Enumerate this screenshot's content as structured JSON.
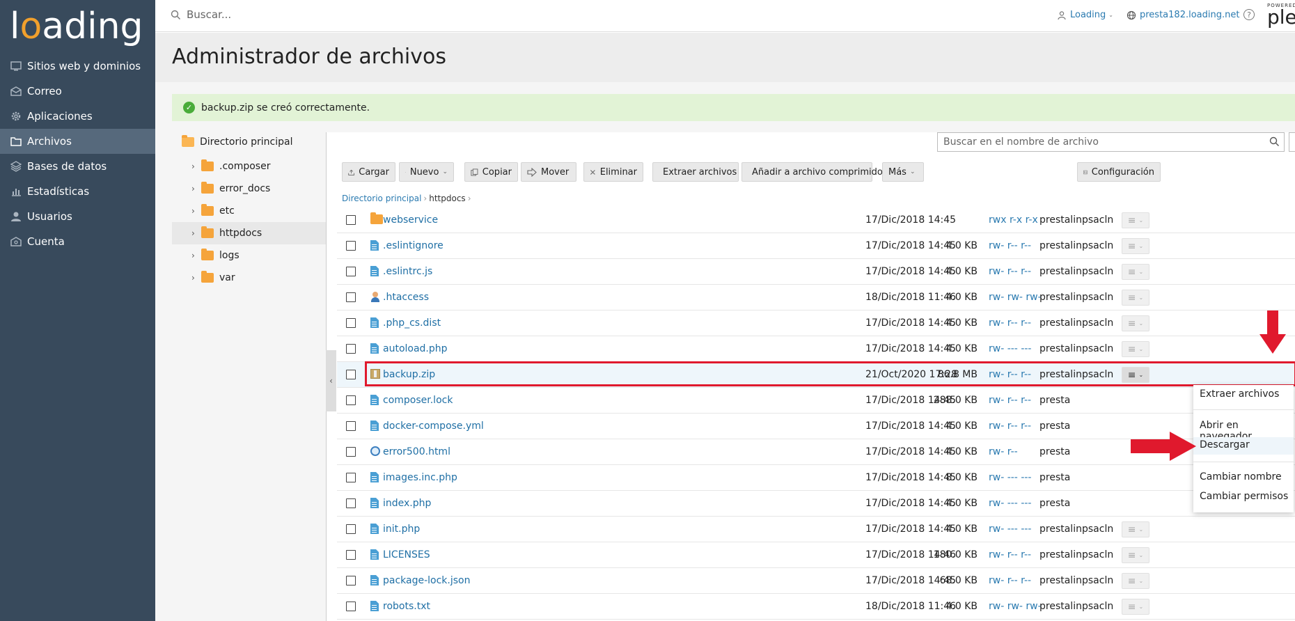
{
  "brand": {
    "logo_prefix": "l",
    "logo_o": "o",
    "logo_suffix": "ading"
  },
  "sidebar": {
    "items": [
      {
        "label": "Sitios web y dominios",
        "icon": "monitor-icon"
      },
      {
        "label": "Correo",
        "icon": "mail-icon"
      },
      {
        "label": "Aplicaciones",
        "icon": "gear-icon"
      },
      {
        "label": "Archivos",
        "icon": "folder-icon",
        "active": true
      },
      {
        "label": "Bases de datos",
        "icon": "database-icon"
      },
      {
        "label": "Estadísticas",
        "icon": "chart-icon"
      },
      {
        "label": "Usuarios",
        "icon": "user-icon"
      },
      {
        "label": "Cuenta",
        "icon": "account-icon"
      }
    ]
  },
  "topbar": {
    "search_placeholder": "Buscar...",
    "user": "Loading",
    "domain": "presta182.loading.net",
    "help": "?",
    "powered": "POWERED",
    "plesk": "ples"
  },
  "page": {
    "title": "Administrador de archivos",
    "alert": "backup.zip se creó correctamente."
  },
  "tree": {
    "root": "Directorio principal",
    "items": [
      {
        "label": ".composer"
      },
      {
        "label": "error_docs"
      },
      {
        "label": "etc"
      },
      {
        "label": "httpdocs",
        "active": true
      },
      {
        "label": "logs"
      },
      {
        "label": "var"
      }
    ]
  },
  "files": {
    "search_placeholder": "Buscar en el nombre de archivo",
    "toolbar": {
      "upload": "Cargar",
      "new": "Nuevo",
      "copy": "Copiar",
      "move": "Mover",
      "delete": "Eliminar",
      "extract": "Extraer archivos",
      "add_archive": "Añadir a archivo comprimido",
      "more": "Más",
      "settings": "Configuración"
    },
    "breadcrumb": {
      "root": "Directorio principal",
      "current": "httpdocs"
    },
    "rows": [
      {
        "name": "webservice",
        "type": "folder",
        "date": "17/Dic/2018 14:45",
        "size": "",
        "perm": "rwx r-x r-x",
        "user": "prestalin",
        "group": "psacln"
      },
      {
        "name": ".eslintignore",
        "type": "doc",
        "date": "17/Dic/2018 14:45",
        "size": "4.0 KB",
        "perm": "rw- r-- r--",
        "user": "prestalin",
        "group": "psacln"
      },
      {
        "name": ".eslintrc.js",
        "type": "doc",
        "date": "17/Dic/2018 14:45",
        "size": "4.0 KB",
        "perm": "rw- r-- r--",
        "user": "prestalin",
        "group": "psacln"
      },
      {
        "name": ".htaccess",
        "type": "htaccess",
        "date": "18/Dic/2018 11:46",
        "size": "4.0 KB",
        "perm": "rw- rw- rw-",
        "user": "prestalin",
        "group": "psacln"
      },
      {
        "name": ".php_cs.dist",
        "type": "doc",
        "date": "17/Dic/2018 14:45",
        "size": "4.0 KB",
        "perm": "rw- r-- r--",
        "user": "prestalin",
        "group": "psacln"
      },
      {
        "name": "autoload.php",
        "type": "doc",
        "date": "17/Dic/2018 14:45",
        "size": "4.0 KB",
        "perm": "rw- --- ---",
        "user": "prestalin",
        "group": "psacln"
      },
      {
        "name": "backup.zip",
        "type": "zip",
        "date": "21/Oct/2020 17:28",
        "size": "86.8 MB",
        "perm": "rw- r-- r--",
        "user": "prestalin",
        "group": "psacln",
        "selected": true
      },
      {
        "name": "composer.lock",
        "type": "doc",
        "date": "17/Dic/2018 14:45",
        "size": "288.0 KB",
        "perm": "rw- r-- r--",
        "user": "presta",
        "group": ""
      },
      {
        "name": "docker-compose.yml",
        "type": "doc",
        "date": "17/Dic/2018 14:45",
        "size": "4.0 KB",
        "perm": "rw- r-- r--",
        "user": "presta",
        "group": ""
      },
      {
        "name": "error500.html",
        "type": "web",
        "date": "17/Dic/2018 14:45",
        "size": "4.0 KB",
        "perm": "rw- r--",
        "user": "presta",
        "group": ""
      },
      {
        "name": "images.inc.php",
        "type": "doc",
        "date": "17/Dic/2018 14:45",
        "size": "8.0 KB",
        "perm": "rw- --- ---",
        "user": "presta",
        "group": ""
      },
      {
        "name": "index.php",
        "type": "doc",
        "date": "17/Dic/2018 14:45",
        "size": "4.0 KB",
        "perm": "rw- --- ---",
        "user": "presta",
        "group": ""
      },
      {
        "name": "init.php",
        "type": "doc",
        "date": "17/Dic/2018 14:45",
        "size": "4.0 KB",
        "perm": "rw- --- ---",
        "user": "prestalin",
        "group": "psacln"
      },
      {
        "name": "LICENSES",
        "type": "doc",
        "date": "17/Dic/2018 14:46",
        "size": "180.0 KB",
        "perm": "rw- r-- r--",
        "user": "prestalin",
        "group": "psacln"
      },
      {
        "name": "package-lock.json",
        "type": "doc",
        "date": "17/Dic/2018 14:45",
        "size": "68.0 KB",
        "perm": "rw- r-- r--",
        "user": "prestalin",
        "group": "psacln"
      },
      {
        "name": "robots.txt",
        "type": "doc",
        "date": "18/Dic/2018 11:46",
        "size": "4.0 KB",
        "perm": "rw- rw- rw-",
        "user": "prestalin",
        "group": "psacln"
      }
    ]
  },
  "context_menu": {
    "extract": "Extraer archivos",
    "open_browser": "Abrir en navegador",
    "download": "Descargar",
    "rename": "Cambiar nombre",
    "permissions": "Cambiar permisos"
  },
  "colors": {
    "sidebar": "#384a5c",
    "accent": "#f1a02c",
    "link": "#2a7ab0",
    "highlight": "#e0192d"
  }
}
